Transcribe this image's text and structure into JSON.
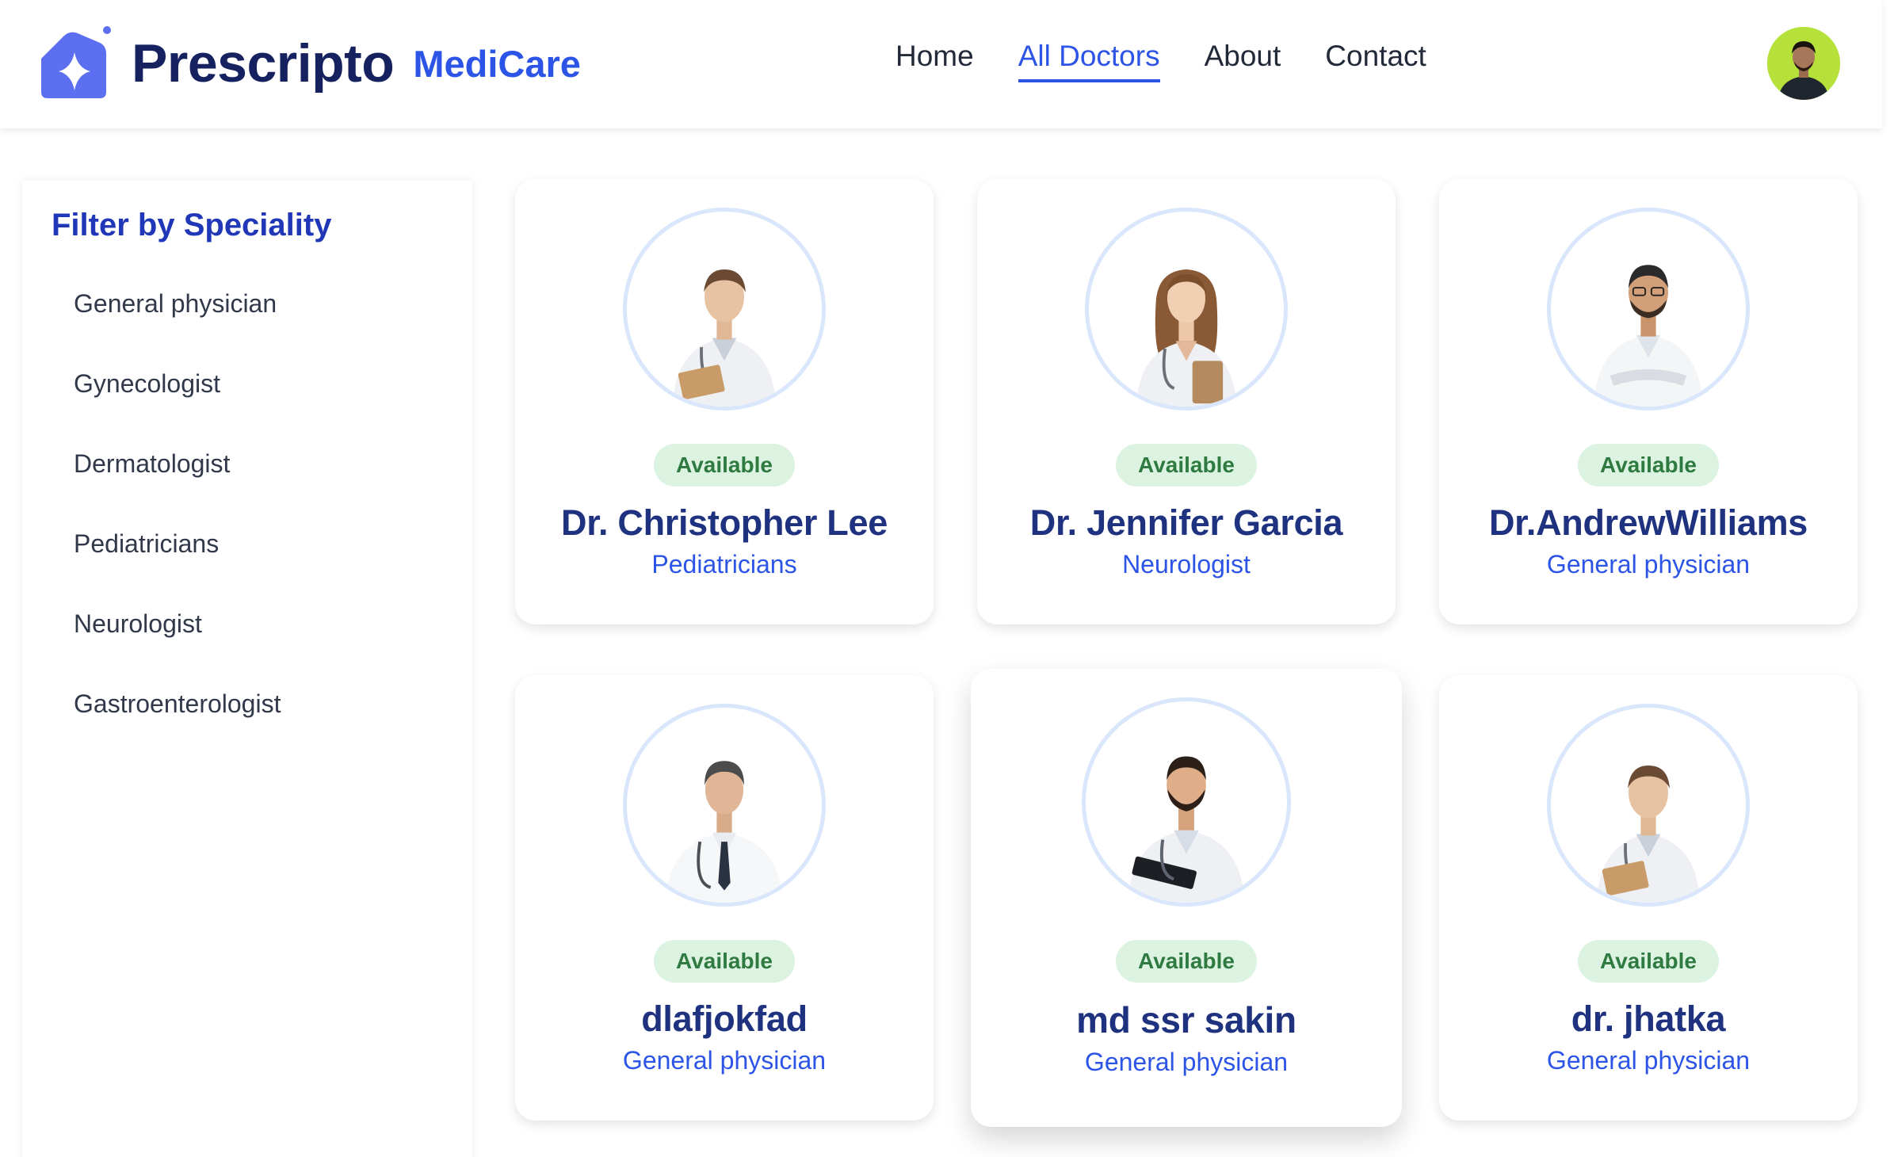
{
  "header": {
    "brand_name": "Prescripto",
    "brand_sub": "MediCare",
    "nav": [
      {
        "label": "Home",
        "active": false
      },
      {
        "label": "All Doctors",
        "active": true
      },
      {
        "label": "About",
        "active": false
      },
      {
        "label": "Contact",
        "active": false
      }
    ],
    "avatar_icon": "user-avatar"
  },
  "sidebar": {
    "title": "Filter by Speciality",
    "items": [
      "General physician",
      "Gynecologist",
      "Dermatologist",
      "Pediatricians",
      "Neurologist",
      "Gastroenterologist"
    ]
  },
  "doctors": [
    {
      "status": "Available",
      "name": "Dr. Christopher Lee",
      "speciality": "Pediatricians"
    },
    {
      "status": "Available",
      "name": "Dr. Jennifer Garcia",
      "speciality": "Neurologist"
    },
    {
      "status": "Available",
      "name": "Dr.AndrewWilliams",
      "speciality": "General physician"
    },
    {
      "status": "Available",
      "name": "dlafjokfad",
      "speciality": "General physician"
    },
    {
      "status": "Available",
      "name": "md ssr sakin",
      "speciality": "General physician"
    },
    {
      "status": "Available",
      "name": "dr. jhatka",
      "speciality": "General physician"
    }
  ],
  "colors": {
    "brand_dark": "#16225f",
    "accent": "#2c54e6",
    "available_bg": "#dcf3e2",
    "available_text": "#2f7a40",
    "photo_ring": "#d9e6fb"
  }
}
